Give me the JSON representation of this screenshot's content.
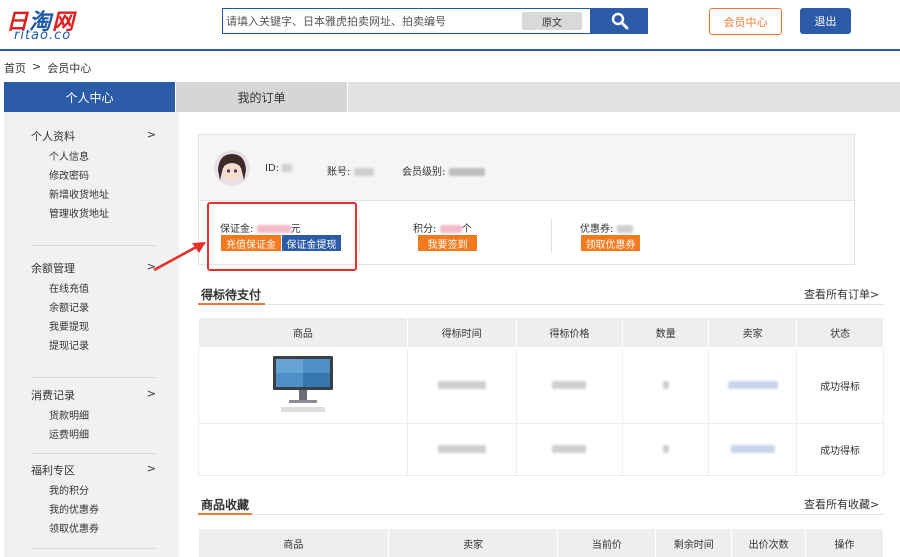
{
  "header": {
    "logo_cn": "日淘网",
    "logo_en": "ritao.co",
    "search_placeholder": "请填入关键字、日本雅虎拍卖网址、拍卖编号",
    "search_toggle": "原文",
    "member_center": "会员中心",
    "logout": "退出"
  },
  "breadcrumb": {
    "home": "首页",
    "sep": ">",
    "current": "会员中心"
  },
  "tabs": {
    "personal": "个人中心",
    "orders": "我的订单"
  },
  "sidebar": {
    "groups": [
      {
        "title": "个人资料",
        "arrow": ">",
        "items": [
          "个人信息",
          "修改密码",
          "新增收货地址",
          "管理收货地址"
        ]
      },
      {
        "title": "余额管理",
        "arrow": ">",
        "items": [
          "在线充值",
          "余额记录",
          "我要提现",
          "提现记录"
        ]
      },
      {
        "title": "消费记录",
        "arrow": ">",
        "items": [
          "货款明细",
          "运费明细"
        ]
      },
      {
        "title": "福利专区",
        "arrow": ">",
        "items": [
          "我的积分",
          "我的优惠券",
          "领取优惠券"
        ]
      }
    ]
  },
  "account": {
    "id_label": "ID:",
    "account_label": "账号:",
    "level_label": "会员级别:",
    "deposit_label": "保证金:",
    "deposit_unit": "元",
    "points_label": "积分:",
    "points_unit": "个",
    "coupon_label": "优惠券:",
    "recharge_btn": "充值保证金",
    "withdraw_btn": "保证金提现",
    "signin_btn": "我要签到",
    "get_coupon_btn": "领取优惠券"
  },
  "pending": {
    "title": "得标待支付",
    "view_all": "查看所有订单>",
    "columns": [
      "商品",
      "得标时间",
      "得标价格",
      "数量",
      "卖家",
      "状态"
    ],
    "rows": [
      {
        "status": "成功得标"
      },
      {
        "status": "成功得标"
      }
    ]
  },
  "favorites": {
    "title": "商品收藏",
    "view_all": "查看所有收藏>",
    "columns": [
      "商品",
      "卖家",
      "当前价",
      "剩余时间",
      "出价次数",
      "操作"
    ]
  },
  "colors": {
    "brand_blue": "#2c5ba7",
    "accent_orange": "#f47a1f",
    "highlight_red": "#e8302a"
  }
}
